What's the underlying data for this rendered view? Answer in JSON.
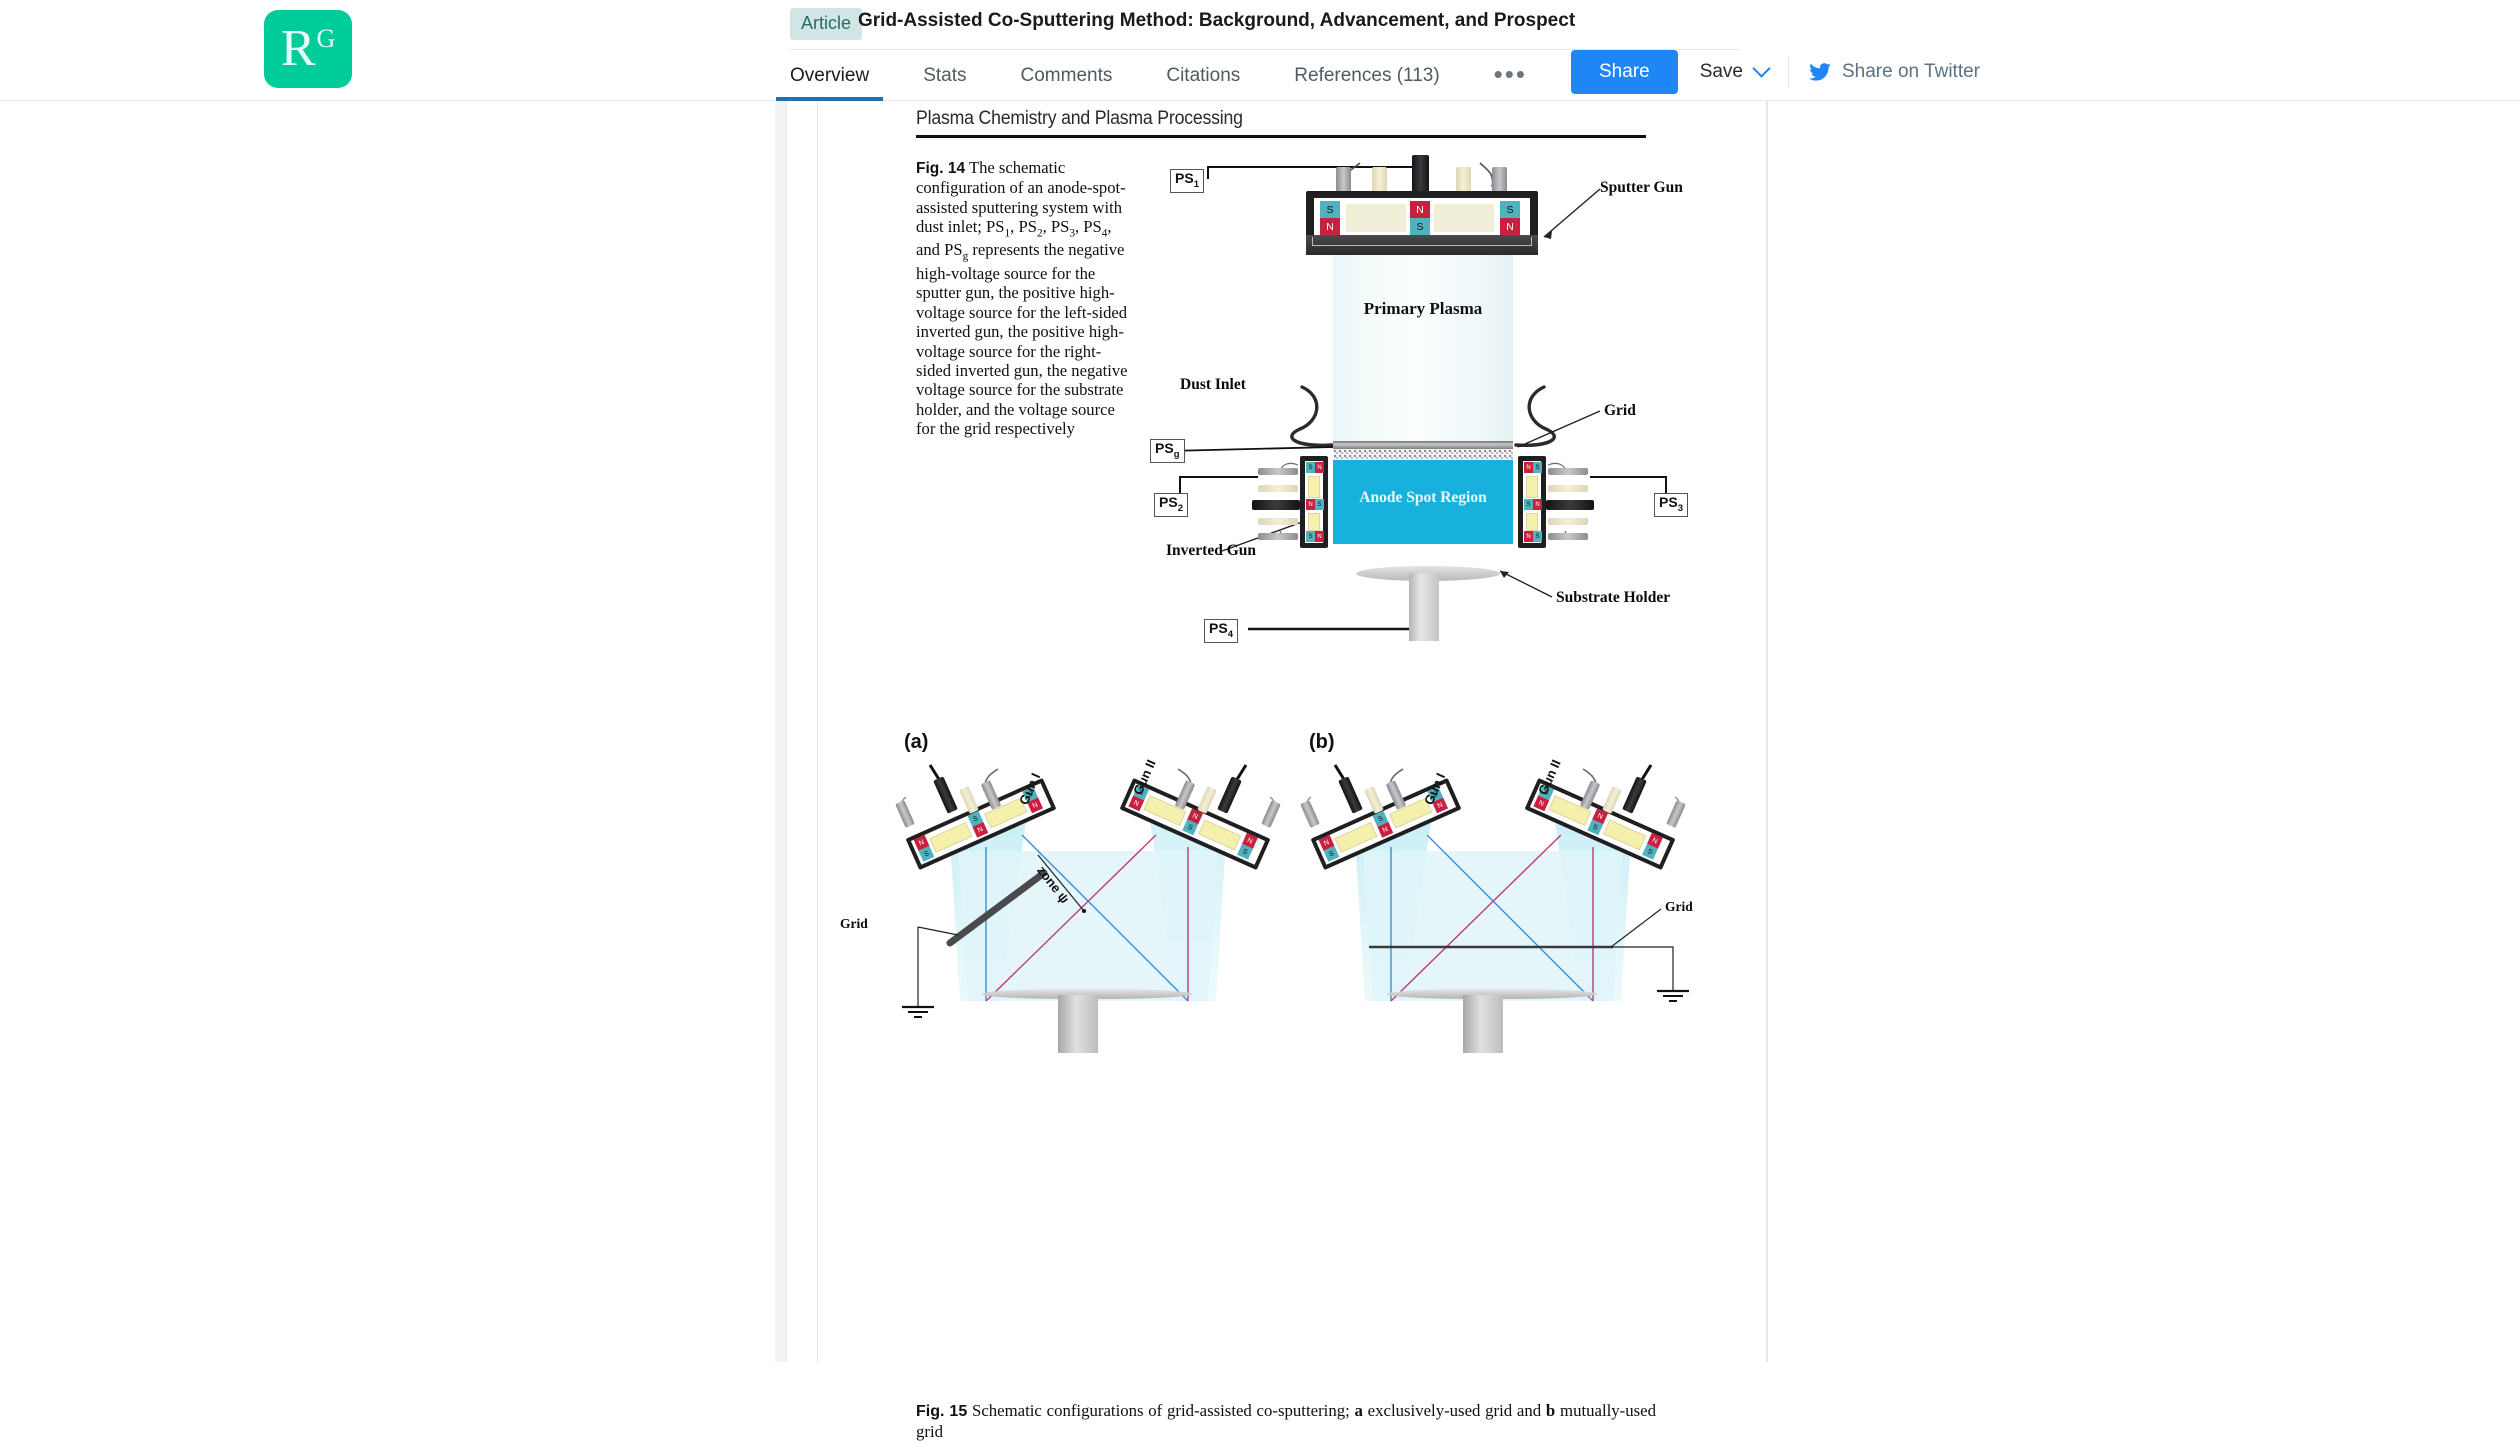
{
  "header": {
    "logo_letter": "R",
    "logo_sup": "G",
    "badge": "Article",
    "title": "Grid-Assisted Co-Sputtering Method: Background, Advancement, and Prospect",
    "tabs": [
      {
        "label": "Overview",
        "active": true
      },
      {
        "label": "Stats",
        "active": false
      },
      {
        "label": "Comments",
        "active": false
      },
      {
        "label": "Citations",
        "active": false
      },
      {
        "label": "References (113)",
        "active": false
      }
    ],
    "more_label": "•••",
    "share_button": "Share",
    "save_label": "Save",
    "twitter_label": "Share on Twitter",
    "accent_color": "#1f86f5",
    "brand_color": "#00cc9a"
  },
  "paper": {
    "running_head": "Plasma Chemistry and Plasma Processing",
    "fig14": {
      "label": "Fig. 14",
      "caption_parts": [
        "The schematic configuration of an anode-spot-assisted sputtering system with dust inlet; PS",
        "1",
        ", PS",
        "2",
        ", PS",
        "3",
        ", PS",
        "4",
        ", and PS",
        "g",
        " represents the negative high-voltage source for the sputter gun, the positive high-voltage source for the left-sided inverted gun, the positive high-voltage source for the right-sided inverted gun, the negative voltage source for the substrate holder, and the voltage source for the grid respectively"
      ],
      "annotations": {
        "sputter_gun": "Sputter Gun",
        "primary_plasma": "Primary Plasma",
        "dust_inlet": "Dust Inlet",
        "grid": "Grid",
        "anode_spot_region": "Anode Spot Region",
        "inverted_gun": "Inverted Gun",
        "substrate_holder": "Substrate Holder"
      },
      "power_supplies": [
        {
          "name": "PS",
          "sub": "1"
        },
        {
          "name": "PS",
          "sub": "2"
        },
        {
          "name": "PS",
          "sub": "3"
        },
        {
          "name": "PS",
          "sub": "4"
        },
        {
          "name": "PS",
          "sub": "g"
        }
      ],
      "magnet_poles": {
        "south": "S",
        "north": "N"
      },
      "colors": {
        "plasma": "#f3fbfb",
        "anode_spot": "#18b0dd",
        "magnet_s": "#4fb3bf",
        "magnet_n": "#c9203f",
        "body": "#1f1f21"
      }
    },
    "fig15": {
      "label": "Fig. 15",
      "caption_lead": "Schematic configurations of grid-assisted co-sputtering;",
      "caption_a_tag": "a",
      "caption_a_text": "exclusively-used grid and",
      "caption_b_tag": "b",
      "caption_b_text": "mutually-used grid",
      "panels": [
        {
          "tag": "(a)",
          "gun_left": "Gun I",
          "gun_right": "Gun II",
          "zone_label": "zone ψ",
          "grid_label": "Grid"
        },
        {
          "tag": "(b)",
          "gun_left": "Gun I",
          "gun_right": "Gun II",
          "grid_label": "Grid"
        }
      ]
    }
  }
}
